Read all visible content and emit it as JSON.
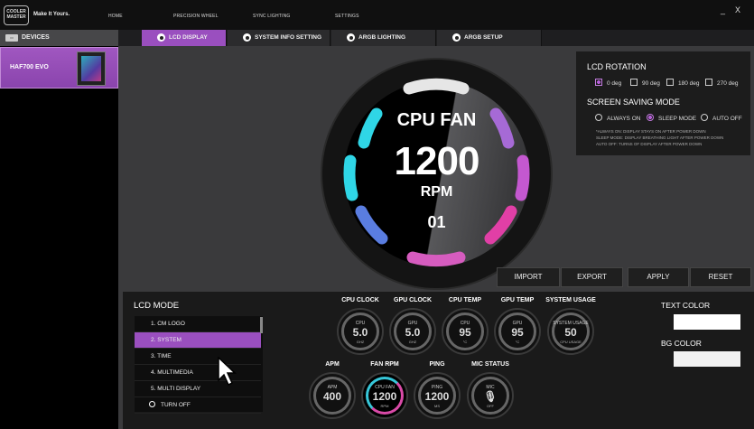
{
  "topbar": {
    "logo_text": "COOLER MASTER",
    "tagline": "Make It Yours.",
    "nav": [
      "HOME",
      "PRECISION WHEEL",
      "SYNC LIGHTING",
      "SETTINGS"
    ],
    "minimize": "_",
    "close": "X"
  },
  "sidebar": {
    "header_label": "DEVICES",
    "device_name": "HAF700 EVO"
  },
  "tabs": [
    {
      "label": "LCD DISPLAY",
      "active": true
    },
    {
      "label": "SYSTEM INFO SETTING",
      "active": false
    },
    {
      "label": "ARGB LIGHTING",
      "active": false
    },
    {
      "label": "ARGB SETUP",
      "active": false
    }
  ],
  "preview": {
    "title": "CPU FAN",
    "value": "1200",
    "unit": "RPM",
    "index": "01",
    "colors": {
      "cyan": "#2fd6e6",
      "blue": "#5a7de0",
      "purple": "#a66ad6",
      "pink": "#e13fa6"
    }
  },
  "settings": {
    "rotation_title": "LCD ROTATION",
    "rotation_options": [
      {
        "label": "0 deg",
        "checked": true
      },
      {
        "label": "90 deg",
        "checked": false
      },
      {
        "label": "180 deg",
        "checked": false
      },
      {
        "label": "270 deg",
        "checked": false
      }
    ],
    "saving_title": "SCREEN SAVING MODE",
    "saving_options": [
      {
        "label": "ALWAYS ON",
        "selected": false
      },
      {
        "label": "SLEEP MODE",
        "selected": true
      },
      {
        "label": "AUTO OFF",
        "selected": false
      }
    ],
    "notes": [
      "*ALWAYS ON: DISPLAY STAYS ON AFTER POWER DOWN",
      "SLEEP MODE: DISPLAY BREATHING LIGHT AFTER POWER DOWN",
      "AUTO OFF: TURNS OF DISPLAY AFTER POWER DOWN"
    ]
  },
  "actions": {
    "import": "IMPORT",
    "export": "EXPORT",
    "apply": "APPLY",
    "reset": "RESET"
  },
  "lcd_mode": {
    "title": "LCD MODE",
    "items": [
      "1. CM LOGO",
      "2. SYSTEM",
      "3. TIME",
      "4. MULTIMEDIA",
      "5. MULTI DISPLAY",
      "TURN OFF"
    ],
    "selected_index": 1
  },
  "gauges": {
    "cpu_clock": {
      "label": "CPU CLOCK",
      "name": "CPU",
      "value": "5.0",
      "unit": "GHZ"
    },
    "gpu_clock": {
      "label": "GPU CLOCK",
      "name": "GPU",
      "value": "5.0",
      "unit": "GHZ"
    },
    "cpu_temp": {
      "label": "CPU TEMP",
      "name": "CPU",
      "value": "95",
      "unit": "°C"
    },
    "gpu_temp": {
      "label": "GPU TEMP",
      "name": "GPU",
      "value": "95",
      "unit": "°C"
    },
    "system_usage": {
      "label": "SYSTEM USAGE",
      "name": "SYSTEM USAGE",
      "value": "50",
      "unit": "CPU USAGE"
    },
    "apm": {
      "label": "APM",
      "name": "APM",
      "value": "400",
      "unit": ""
    },
    "fan_rpm": {
      "label": "FAN RPM",
      "name": "CPU FAN",
      "value": "1200",
      "unit": "RPM"
    },
    "ping": {
      "label": "PING",
      "name": "PING",
      "value": "1200",
      "unit": "MS"
    },
    "mic_status": {
      "label": "MIC STATUS",
      "name": "MIC",
      "value": "",
      "unit": "OFF"
    }
  },
  "colors": {
    "text_color_label": "TEXT COLOR",
    "bg_color_label": "BG COLOR",
    "text_color": "#ffffff",
    "bg_color": "#f2f2f2"
  }
}
